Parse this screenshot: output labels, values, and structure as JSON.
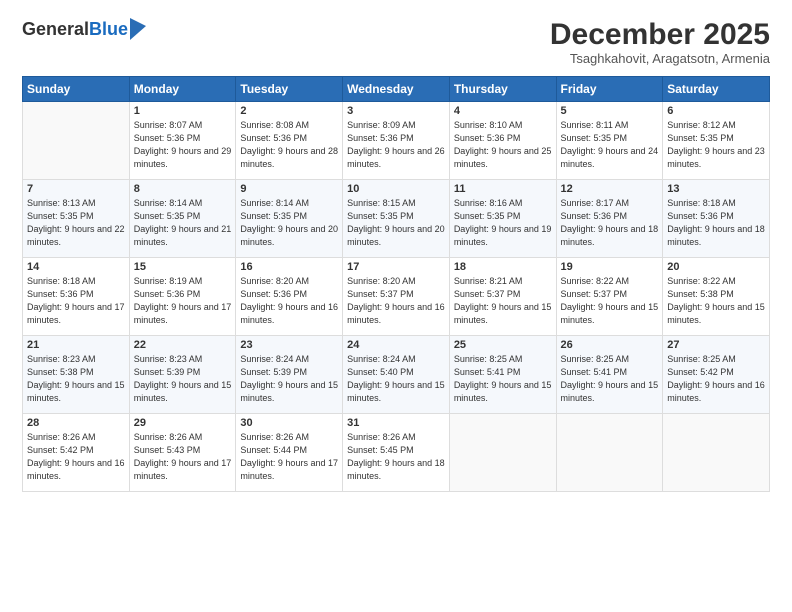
{
  "header": {
    "logo": {
      "general": "General",
      "blue": "Blue"
    },
    "title": "December 2025",
    "location": "Tsaghkahovit, Aragatsotn, Armenia"
  },
  "weekdays": [
    "Sunday",
    "Monday",
    "Tuesday",
    "Wednesday",
    "Thursday",
    "Friday",
    "Saturday"
  ],
  "weeks": [
    [
      {
        "day": "",
        "sunrise": "",
        "sunset": "",
        "daylight": ""
      },
      {
        "day": "1",
        "sunrise": "Sunrise: 8:07 AM",
        "sunset": "Sunset: 5:36 PM",
        "daylight": "Daylight: 9 hours and 29 minutes."
      },
      {
        "day": "2",
        "sunrise": "Sunrise: 8:08 AM",
        "sunset": "Sunset: 5:36 PM",
        "daylight": "Daylight: 9 hours and 28 minutes."
      },
      {
        "day": "3",
        "sunrise": "Sunrise: 8:09 AM",
        "sunset": "Sunset: 5:36 PM",
        "daylight": "Daylight: 9 hours and 26 minutes."
      },
      {
        "day": "4",
        "sunrise": "Sunrise: 8:10 AM",
        "sunset": "Sunset: 5:36 PM",
        "daylight": "Daylight: 9 hours and 25 minutes."
      },
      {
        "day": "5",
        "sunrise": "Sunrise: 8:11 AM",
        "sunset": "Sunset: 5:35 PM",
        "daylight": "Daylight: 9 hours and 24 minutes."
      },
      {
        "day": "6",
        "sunrise": "Sunrise: 8:12 AM",
        "sunset": "Sunset: 5:35 PM",
        "daylight": "Daylight: 9 hours and 23 minutes."
      }
    ],
    [
      {
        "day": "7",
        "sunrise": "Sunrise: 8:13 AM",
        "sunset": "Sunset: 5:35 PM",
        "daylight": "Daylight: 9 hours and 22 minutes."
      },
      {
        "day": "8",
        "sunrise": "Sunrise: 8:14 AM",
        "sunset": "Sunset: 5:35 PM",
        "daylight": "Daylight: 9 hours and 21 minutes."
      },
      {
        "day": "9",
        "sunrise": "Sunrise: 8:14 AM",
        "sunset": "Sunset: 5:35 PM",
        "daylight": "Daylight: 9 hours and 20 minutes."
      },
      {
        "day": "10",
        "sunrise": "Sunrise: 8:15 AM",
        "sunset": "Sunset: 5:35 PM",
        "daylight": "Daylight: 9 hours and 20 minutes."
      },
      {
        "day": "11",
        "sunrise": "Sunrise: 8:16 AM",
        "sunset": "Sunset: 5:35 PM",
        "daylight": "Daylight: 9 hours and 19 minutes."
      },
      {
        "day": "12",
        "sunrise": "Sunrise: 8:17 AM",
        "sunset": "Sunset: 5:36 PM",
        "daylight": "Daylight: 9 hours and 18 minutes."
      },
      {
        "day": "13",
        "sunrise": "Sunrise: 8:18 AM",
        "sunset": "Sunset: 5:36 PM",
        "daylight": "Daylight: 9 hours and 18 minutes."
      }
    ],
    [
      {
        "day": "14",
        "sunrise": "Sunrise: 8:18 AM",
        "sunset": "Sunset: 5:36 PM",
        "daylight": "Daylight: 9 hours and 17 minutes."
      },
      {
        "day": "15",
        "sunrise": "Sunrise: 8:19 AM",
        "sunset": "Sunset: 5:36 PM",
        "daylight": "Daylight: 9 hours and 17 minutes."
      },
      {
        "day": "16",
        "sunrise": "Sunrise: 8:20 AM",
        "sunset": "Sunset: 5:36 PM",
        "daylight": "Daylight: 9 hours and 16 minutes."
      },
      {
        "day": "17",
        "sunrise": "Sunrise: 8:20 AM",
        "sunset": "Sunset: 5:37 PM",
        "daylight": "Daylight: 9 hours and 16 minutes."
      },
      {
        "day": "18",
        "sunrise": "Sunrise: 8:21 AM",
        "sunset": "Sunset: 5:37 PM",
        "daylight": "Daylight: 9 hours and 15 minutes."
      },
      {
        "day": "19",
        "sunrise": "Sunrise: 8:22 AM",
        "sunset": "Sunset: 5:37 PM",
        "daylight": "Daylight: 9 hours and 15 minutes."
      },
      {
        "day": "20",
        "sunrise": "Sunrise: 8:22 AM",
        "sunset": "Sunset: 5:38 PM",
        "daylight": "Daylight: 9 hours and 15 minutes."
      }
    ],
    [
      {
        "day": "21",
        "sunrise": "Sunrise: 8:23 AM",
        "sunset": "Sunset: 5:38 PM",
        "daylight": "Daylight: 9 hours and 15 minutes."
      },
      {
        "day": "22",
        "sunrise": "Sunrise: 8:23 AM",
        "sunset": "Sunset: 5:39 PM",
        "daylight": "Daylight: 9 hours and 15 minutes."
      },
      {
        "day": "23",
        "sunrise": "Sunrise: 8:24 AM",
        "sunset": "Sunset: 5:39 PM",
        "daylight": "Daylight: 9 hours and 15 minutes."
      },
      {
        "day": "24",
        "sunrise": "Sunrise: 8:24 AM",
        "sunset": "Sunset: 5:40 PM",
        "daylight": "Daylight: 9 hours and 15 minutes."
      },
      {
        "day": "25",
        "sunrise": "Sunrise: 8:25 AM",
        "sunset": "Sunset: 5:41 PM",
        "daylight": "Daylight: 9 hours and 15 minutes."
      },
      {
        "day": "26",
        "sunrise": "Sunrise: 8:25 AM",
        "sunset": "Sunset: 5:41 PM",
        "daylight": "Daylight: 9 hours and 15 minutes."
      },
      {
        "day": "27",
        "sunrise": "Sunrise: 8:25 AM",
        "sunset": "Sunset: 5:42 PM",
        "daylight": "Daylight: 9 hours and 16 minutes."
      }
    ],
    [
      {
        "day": "28",
        "sunrise": "Sunrise: 8:26 AM",
        "sunset": "Sunset: 5:42 PM",
        "daylight": "Daylight: 9 hours and 16 minutes."
      },
      {
        "day": "29",
        "sunrise": "Sunrise: 8:26 AM",
        "sunset": "Sunset: 5:43 PM",
        "daylight": "Daylight: 9 hours and 17 minutes."
      },
      {
        "day": "30",
        "sunrise": "Sunrise: 8:26 AM",
        "sunset": "Sunset: 5:44 PM",
        "daylight": "Daylight: 9 hours and 17 minutes."
      },
      {
        "day": "31",
        "sunrise": "Sunrise: 8:26 AM",
        "sunset": "Sunset: 5:45 PM",
        "daylight": "Daylight: 9 hours and 18 minutes."
      },
      {
        "day": "",
        "sunrise": "",
        "sunset": "",
        "daylight": ""
      },
      {
        "day": "",
        "sunrise": "",
        "sunset": "",
        "daylight": ""
      },
      {
        "day": "",
        "sunrise": "",
        "sunset": "",
        "daylight": ""
      }
    ]
  ]
}
